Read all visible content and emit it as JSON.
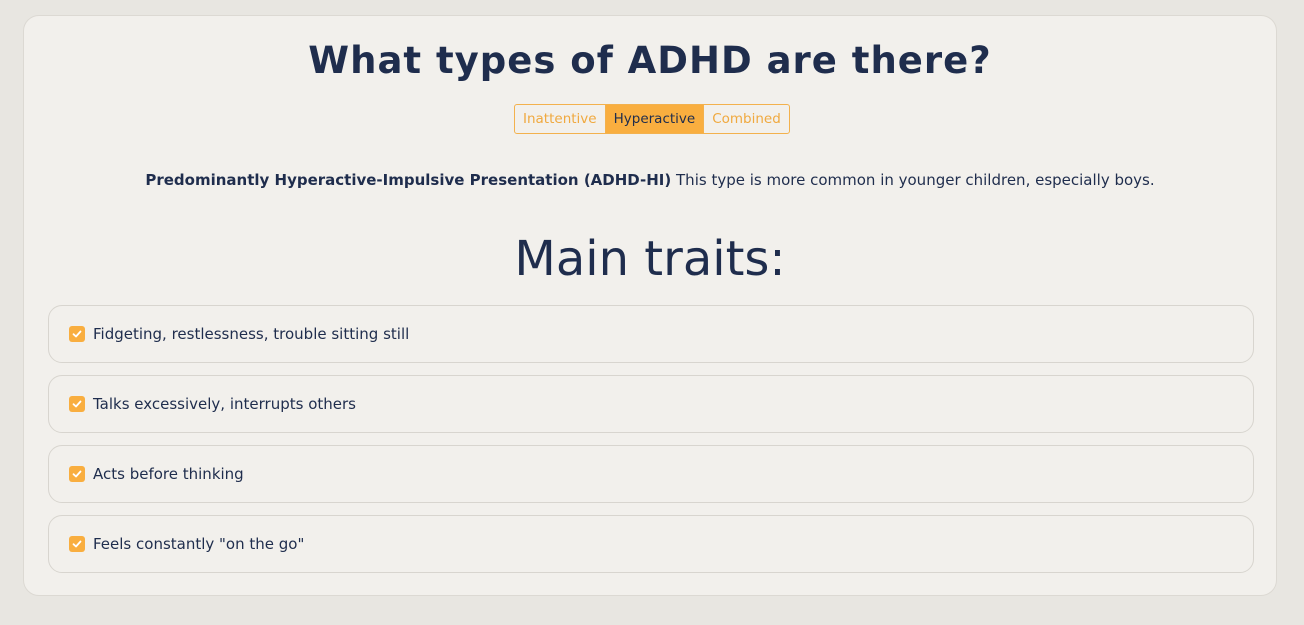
{
  "title": "What types of ADHD are there?",
  "tabs": [
    {
      "label": "Inattentive",
      "active": false
    },
    {
      "label": "Hyperactive",
      "active": true
    },
    {
      "label": "Combined",
      "active": false
    }
  ],
  "description": {
    "bold": "Predominantly Hyperactive-Impulsive Presentation (ADHD-HI)",
    "text": " This type is more common in younger children, especially boys."
  },
  "subtitle": "Main traits:",
  "traits": [
    {
      "label": "Fidgeting, restlessness, trouble sitting still",
      "checked": true
    },
    {
      "label": "Talks excessively, interrupts others",
      "checked": true
    },
    {
      "label": "Acts before thinking",
      "checked": true
    },
    {
      "label": "Feels constantly \"on the go\"",
      "checked": true
    }
  ],
  "colors": {
    "accent": "#f9ae3f",
    "text": "#1f2d4d",
    "card_bg": "#f2f0ec",
    "page_bg": "#e8e6e1"
  },
  "icons": {
    "check": "checkbox-checked-icon"
  }
}
